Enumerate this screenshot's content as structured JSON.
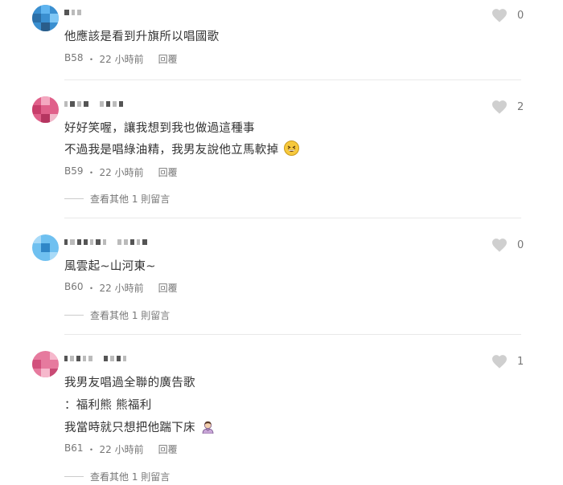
{
  "comments": [
    {
      "lines": [
        "他應該是看到升旗所以唱國歌"
      ],
      "floor": "B58",
      "time": "22 小時前",
      "reply_label": "回覆",
      "likes": "0",
      "more_replies": null
    },
    {
      "lines": [
        "好好笑喔，讓我想到我也做過這種事",
        "不過我是唱綠油精，我男友說他立馬軟掉"
      ],
      "floor": "B59",
      "time": "22 小時前",
      "reply_label": "回覆",
      "likes": "2",
      "more_replies": "查看其他 1 則留言"
    },
    {
      "lines": [
        "風雲起~山河東~"
      ],
      "floor": "B60",
      "time": "22 小時前",
      "reply_label": "回覆",
      "likes": "0",
      "more_replies": "查看其他 1 則留言"
    },
    {
      "lines": [
        "我男友唱過全聯的廣告歌",
        "：福利熊 熊福利",
        "我當時就只想把他踹下床"
      ],
      "floor": "B61",
      "time": "22 小時前",
      "reply_label": "回覆",
      "likes": "1",
      "more_replies": "查看其他 1 則留言"
    }
  ],
  "icons": {
    "like": "heart-icon",
    "emoji_laugh": "grinning-sweat-emoji",
    "emoji_woman": "woman-gesturing-emoji"
  },
  "colors": {
    "heart": "#cfcfcf",
    "text": "#333333",
    "meta": "#777777"
  }
}
